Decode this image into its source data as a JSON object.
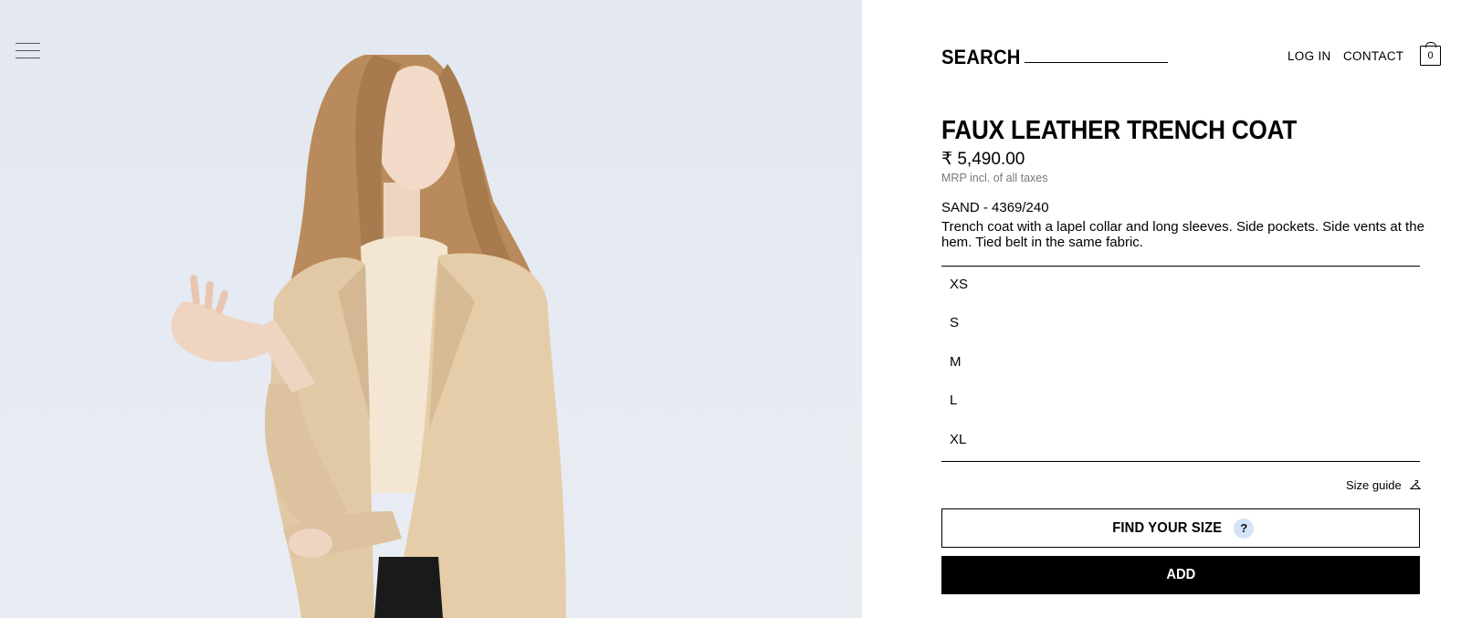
{
  "header": {
    "search_label": "SEARCH",
    "login_label": "LOG IN",
    "contact_label": "CONTACT",
    "cart_count": "0"
  },
  "product": {
    "title": "FAUX LEATHER TRENCH COAT",
    "price": "₹ 5,490.00",
    "tax_note": "MRP incl. of all taxes",
    "color_ref": "SAND - 4369/240",
    "description": "Trench coat with a lapel collar and long sleeves. Side pockets. Side vents at the hem. Tied belt in the same fabric."
  },
  "sizes": [
    "XS",
    "S",
    "M",
    "L",
    "XL"
  ],
  "size_guide": {
    "label": "Size guide",
    "icon": "hanger-icon"
  },
  "actions": {
    "find_size_label": "FIND YOUR SIZE",
    "help_icon": "?",
    "add_label": "ADD"
  },
  "colors": {
    "photo_background": "#e6eaf2",
    "coat": "#e2c9a6",
    "hair": "#b98b5c",
    "help_badge": "#d4e3f5",
    "add_button": "#000000"
  },
  "icons": [
    "hamburger-menu-icon",
    "cart-bag-icon",
    "hanger-icon",
    "question-icon"
  ]
}
